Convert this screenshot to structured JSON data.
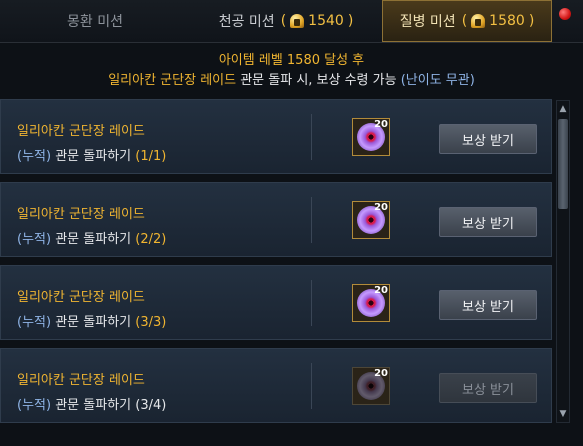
{
  "tabs": [
    {
      "label": "몽환 미션",
      "gold": ""
    },
    {
      "label": "천공 미션",
      "gold": "1540"
    },
    {
      "label": "질병 미션",
      "gold": "1580"
    }
  ],
  "header": {
    "line1": "아이템 레벨 1580 달성 후",
    "line2_gold": "일리아칸 군단장 레이드",
    "line2_white": "관문 돌파 시, 보상 수령 가능",
    "line2_blue": "(난이도 무관)"
  },
  "rows": [
    {
      "title": "일리아칸 군단장 레이드",
      "acc": "(누적)",
      "desc": "관문 돌파하기",
      "count": "(1/1)",
      "item_count": "20",
      "button": "보상 받기",
      "enabled": true
    },
    {
      "title": "일리아칸 군단장 레이드",
      "acc": "(누적)",
      "desc": "관문 돌파하기",
      "count": "(2/2)",
      "item_count": "20",
      "button": "보상 받기",
      "enabled": true
    },
    {
      "title": "일리아칸 군단장 레이드",
      "acc": "(누적)",
      "desc": "관문 돌파하기",
      "count": "(3/3)",
      "item_count": "20",
      "button": "보상 받기",
      "enabled": true
    },
    {
      "title": "일리아칸 군단장 레이드",
      "acc": "(누적)",
      "desc": "관문 돌파하기",
      "count": "(3/4)",
      "item_count": "20",
      "button": "보상 받기",
      "enabled": false
    }
  ],
  "colors": {
    "gold": "#f0b531",
    "blue": "#8fb4e6",
    "active_tab_border": "#8d7135",
    "notice_dot": "#d31515"
  },
  "icons": {
    "currency": "gold-helmet-icon",
    "reward_item": "purple-eye-icon"
  }
}
